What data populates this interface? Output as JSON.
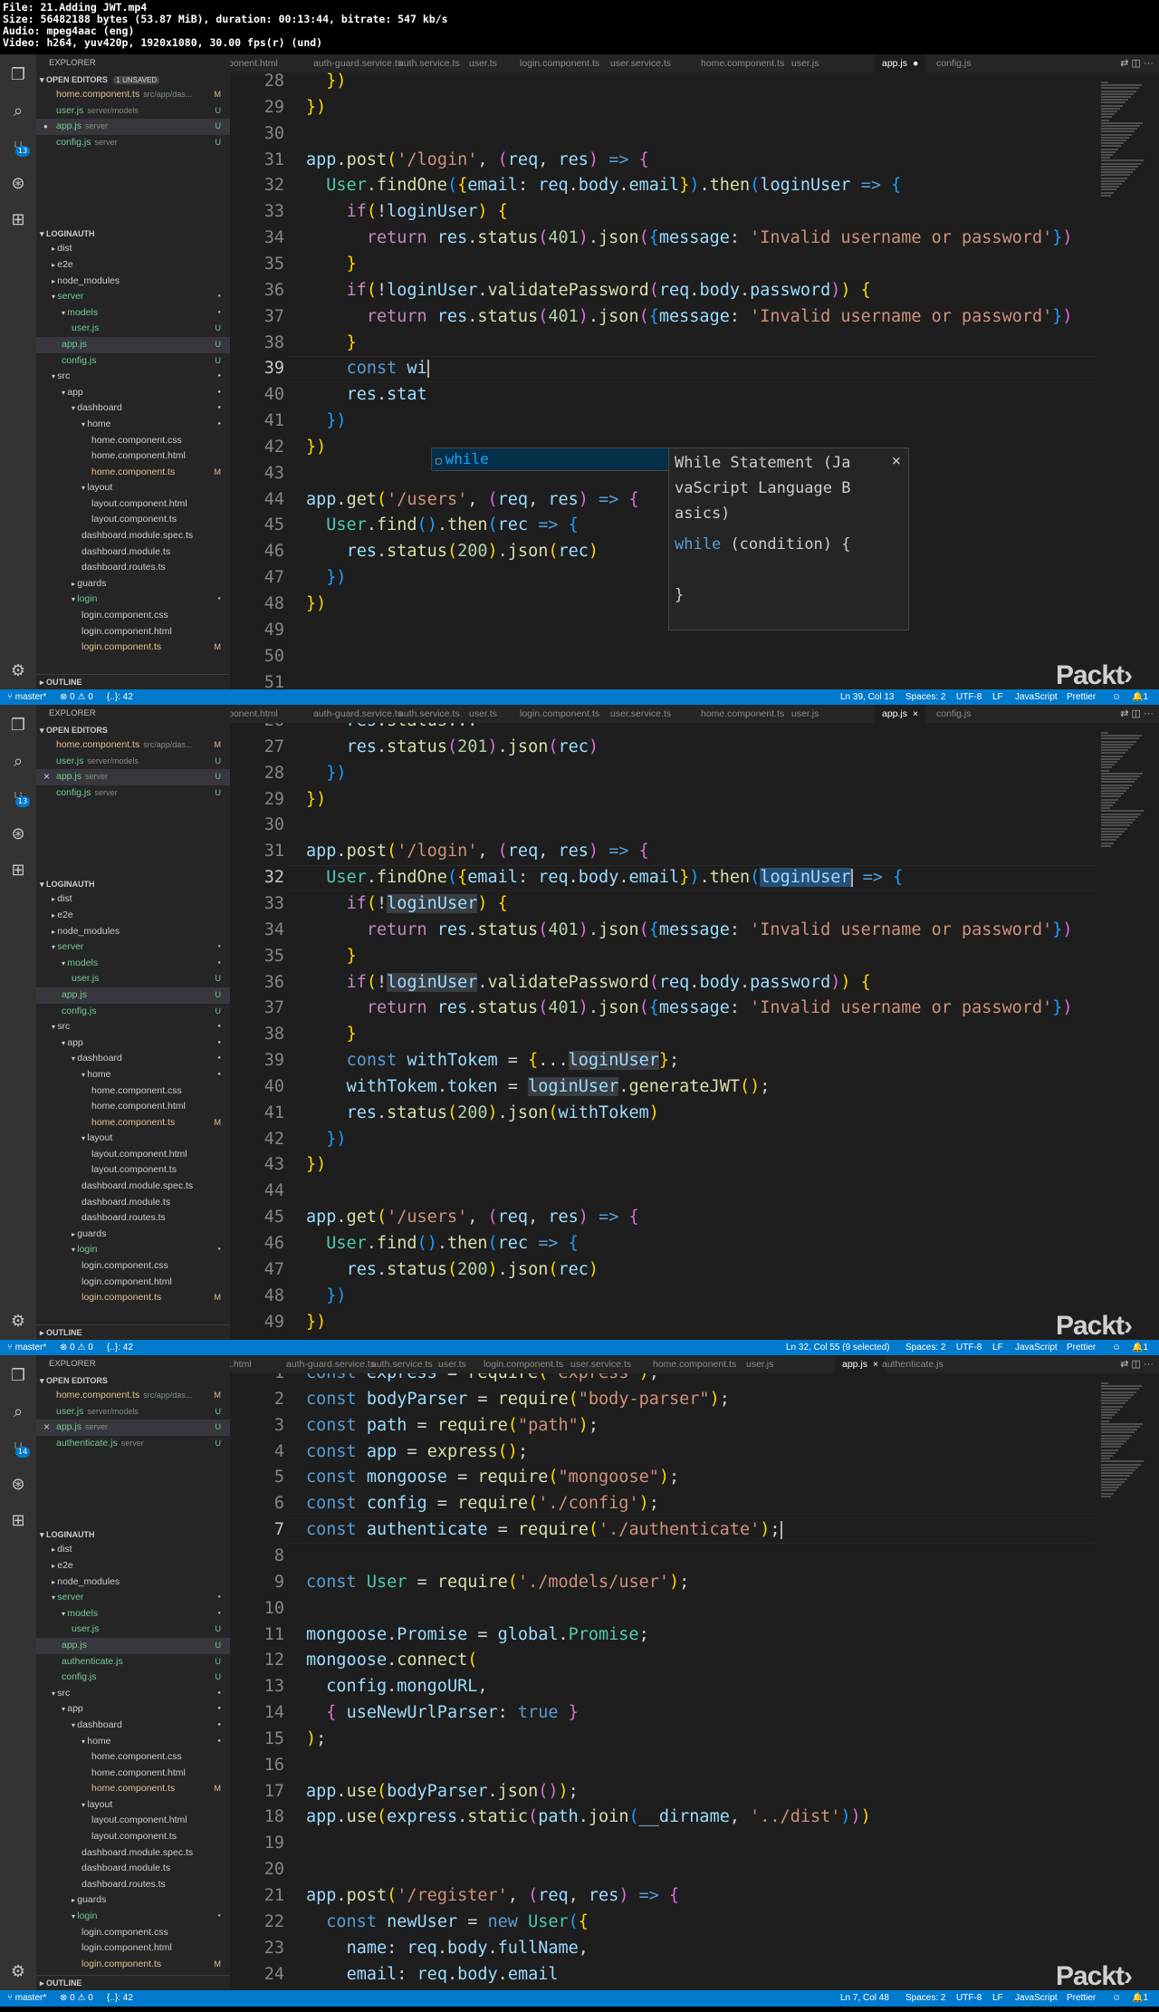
{
  "header": {
    "line1": "File: 21.Adding JWT.mp4",
    "line2": "Size: 56482188 bytes (53.87 MiB), duration: 00:13:44, bitrate: 547 kb/s",
    "line3": "Audio: mpeg4aac (eng)",
    "line4": "Video: h264, yuv420p, 1920x1080, 30.00 fps(r) (und)"
  },
  "common": {
    "explorer_title": "EXPLORER",
    "open_editors": "OPEN EDITORS",
    "unsaved": "1 UNSAVED",
    "project": "LOGINAUTH",
    "outline": "OUTLINE",
    "brand": "Packt›",
    "branch": "⑂ master*",
    "problems": "⊗ 0 ⚠ 0",
    "ctx": "{..}: 42",
    "spaces": "Spaces: 2",
    "encoding": "UTF-8",
    "eol": "LF",
    "language": "JavaScript",
    "formatter": "Prettier",
    "bell": "🔔1"
  },
  "frame1": {
    "badge": "13",
    "open_editors": [
      {
        "name": "home.component.ts",
        "path": "src/app/das...",
        "status": "M"
      },
      {
        "name": "user.js",
        "path": "server/models",
        "status": "U"
      },
      {
        "name": "app.js",
        "path": "server",
        "status": "U"
      },
      {
        "name": "config.js",
        "path": "server",
        "status": "U"
      }
    ],
    "tabs": [
      "ponent.html",
      "auth-guard.service.ts",
      "auth.service.ts",
      "user.ts",
      "login.component.ts",
      "user.service.ts",
      "home.component.ts",
      "user.js",
      "app.js",
      "config.js"
    ],
    "status_pos": "Ln 39, Col 13",
    "suggest": "while",
    "doc_title": "While Statement (JavaScript Language Basics)",
    "doc_title_l1": "While Statement (Ja",
    "doc_title_l2": "vaScript Language B",
    "doc_title_l3": "asics)",
    "doc_code1": "while (condition) {",
    "doc_code2": "}",
    "doc_close": "×"
  },
  "frame2": {
    "badge": "13",
    "open_editors": [
      {
        "name": "home.component.ts",
        "path": "src/app/das...",
        "status": "M"
      },
      {
        "name": "user.js",
        "path": "server/models",
        "status": "U"
      },
      {
        "name": "app.js",
        "path": "server",
        "status": "U"
      },
      {
        "name": "config.js",
        "path": "server",
        "status": "U"
      }
    ],
    "tabs": [
      "ponent.html",
      "auth-guard.service.ts",
      "auth.service.ts",
      "user.ts",
      "login.component.ts",
      "user.service.ts",
      "home.component.ts",
      "user.js",
      "app.js",
      "config.js"
    ],
    "status_pos": "Ln 32, Col 55 (9 selected)"
  },
  "frame3": {
    "badge": "14",
    "open_editors": [
      {
        "name": "home.component.ts",
        "path": "src/app/das...",
        "status": "M"
      },
      {
        "name": "user.js",
        "path": "server/models",
        "status": "U"
      },
      {
        "name": "app.js",
        "path": "server",
        "status": "U"
      },
      {
        "name": "authenticate.js",
        "path": "server",
        "status": "U"
      }
    ],
    "tabs": [
      "t.html",
      "auth-guard.service.ts",
      "auth.service.ts",
      "user.ts",
      "login.component.ts",
      "user.service.ts",
      "home.component.ts",
      "user.js",
      "app.js",
      "authenticate.js"
    ],
    "status_pos": "Ln 7, Col 48"
  },
  "tree": {
    "dist": "dist",
    "e2e": "e2e",
    "node_modules": "node_modules",
    "server": "server",
    "models": "models",
    "user_js": "user.js",
    "app_js": "app.js",
    "config_js": "config.js",
    "authenticate_js": "authenticate.js",
    "src": "src",
    "app": "app",
    "dashboard": "dashboard",
    "home": "home",
    "home_css": "home.component.css",
    "home_html": "home.component.html",
    "home_ts": "home.component.ts",
    "layout": "layout",
    "layout_html": "layout.component.html",
    "layout_ts": "layout.component.ts",
    "dash_spec": "dashboard.module.spec.ts",
    "dash_mod": "dashboard.module.ts",
    "dash_routes": "dashboard.routes.ts",
    "guards": "guards",
    "login": "login",
    "login_css": "login.component.css",
    "login_html": "login.component.html",
    "login_ts": "login.component.ts"
  }
}
